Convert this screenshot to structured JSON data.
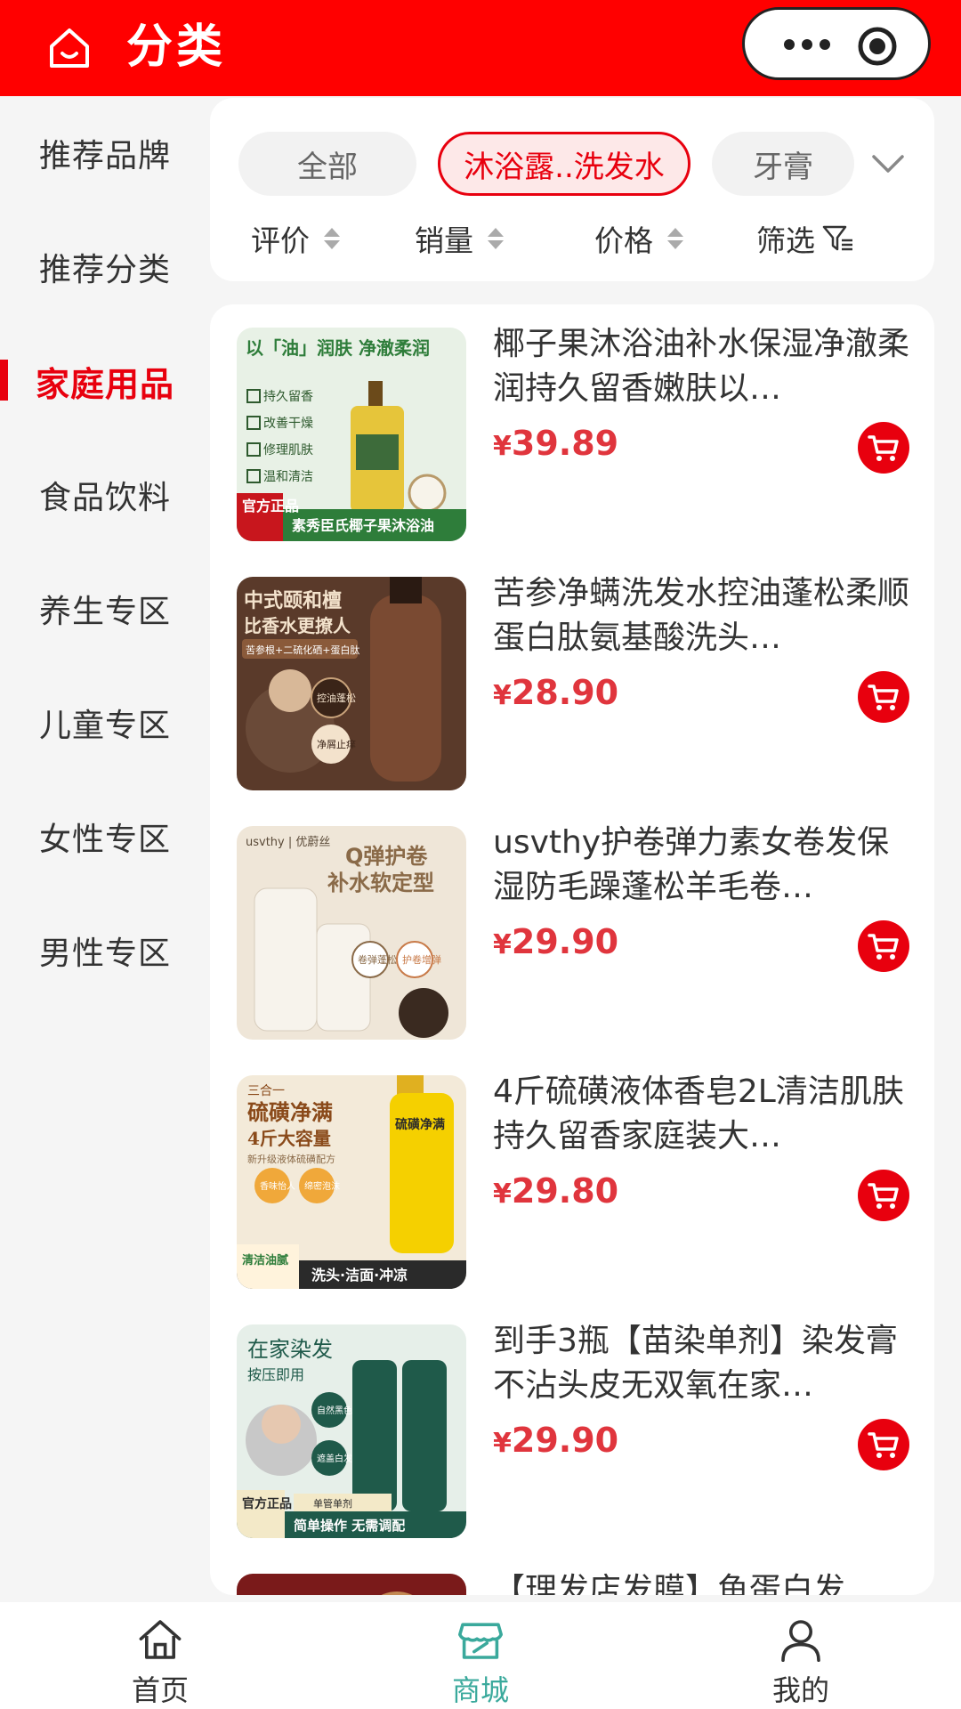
{
  "header": {
    "title": "分类"
  },
  "sidebar": {
    "items": [
      {
        "label": "推荐品牌",
        "active": false
      },
      {
        "label": "推荐分类",
        "active": false
      },
      {
        "label": "家庭用品",
        "active": true
      },
      {
        "label": "食品饮料",
        "active": false
      },
      {
        "label": "养生专区",
        "active": false
      },
      {
        "label": "儿童专区",
        "active": false
      },
      {
        "label": "女性专区",
        "active": false
      },
      {
        "label": "男性专区",
        "active": false
      }
    ]
  },
  "filters": {
    "chips": [
      {
        "label": "全部",
        "active": false
      },
      {
        "label": "沐浴露..洗发水",
        "active": true
      },
      {
        "label": "牙膏",
        "active": false
      }
    ],
    "sort": [
      {
        "label": "评价"
      },
      {
        "label": "销量"
      },
      {
        "label": "价格"
      },
      {
        "label": "筛选"
      }
    ]
  },
  "products": [
    {
      "name": "椰子果沐浴油补水保湿净澈柔润持久留香嫩肤以…",
      "price_symbol": "¥",
      "price": "39.89",
      "thumb": {
        "bg": "#e8f1e6",
        "accent": "#2e7d3a",
        "headline": "以「油」润肤 净澈柔润",
        "bullets": [
          "持久留香",
          "改善干燥",
          "修理肌肤",
          "温和清洁"
        ],
        "badge": "官方正品",
        "footer": "素秀臣氏椰子果沐浴油"
      }
    },
    {
      "name": "苦参净螨洗发水控油蓬松柔顺蛋白肽氨基酸洗头…",
      "price_symbol": "¥",
      "price": "28.90",
      "thumb": {
        "bg": "#5a3a2a",
        "accent": "#e8d6c2",
        "headline": "中式颐和檀",
        "sub": "比香水更撩人",
        "line": "苦参根+二硫化硒+蛋白肽",
        "tags": [
          "控油蓬松",
          "净屑止痒"
        ]
      }
    },
    {
      "name": "usvthy护卷弹力素女卷发保湿防毛躁蓬松羊毛卷…",
      "price_symbol": "¥",
      "price": "29.90",
      "thumb": {
        "bg": "#efe6d8",
        "accent": "#8a6a48",
        "brand": "usvthy | 优蔚丝",
        "headline": "Q弹护卷",
        "sub": "补水软定型",
        "tags": [
          "卷弹蓬松",
          "护卷增弹"
        ]
      }
    },
    {
      "name": "4斤硫磺液体香皂2L清洁肌肤持久留香家庭装大…",
      "price_symbol": "¥",
      "price": "29.80",
      "thumb": {
        "bg": "#f3ead9",
        "accent": "#8a4a1a",
        "top": "三合一",
        "headline": "硫磺净满",
        "sub": "4斤大容量",
        "line": "新升级液体硫磺配方",
        "tags": [
          "香味怡人",
          "绵密泡沫"
        ],
        "footer_left": "清洁油腻",
        "footer": "洗头·洁面·冲凉",
        "bottle": "硫磺净满"
      }
    },
    {
      "name": "到手3瓶【苗染单剂】染发膏不沾头皮无双氧在家…",
      "price_symbol": "¥",
      "price": "29.90",
      "thumb": {
        "bg": "#e6efe9",
        "accent": "#1f5a4a",
        "headline": "在家染发",
        "sub": "按压即用",
        "tags": [
          "自然黑色",
          "遮盖白发"
        ],
        "badge": "官方正品",
        "ribbon": "单管单剂",
        "footer": "简单操作 无需调配"
      }
    },
    {
      "name": "【理发店发膜】鱼蛋白发",
      "price_symbol": "¥",
      "price": "",
      "thumb": {
        "bg": "#7a1a1a",
        "accent": "#f4d37a",
        "headline": ""
      }
    }
  ],
  "bottom_nav": {
    "tabs": [
      {
        "label": "首页",
        "active": false
      },
      {
        "label": "商城",
        "active": true
      },
      {
        "label": "我的",
        "active": false
      }
    ]
  },
  "colors": {
    "brand_red": "#ff0000",
    "price_red": "#e0353d",
    "nav_active": "#3aa99c"
  }
}
